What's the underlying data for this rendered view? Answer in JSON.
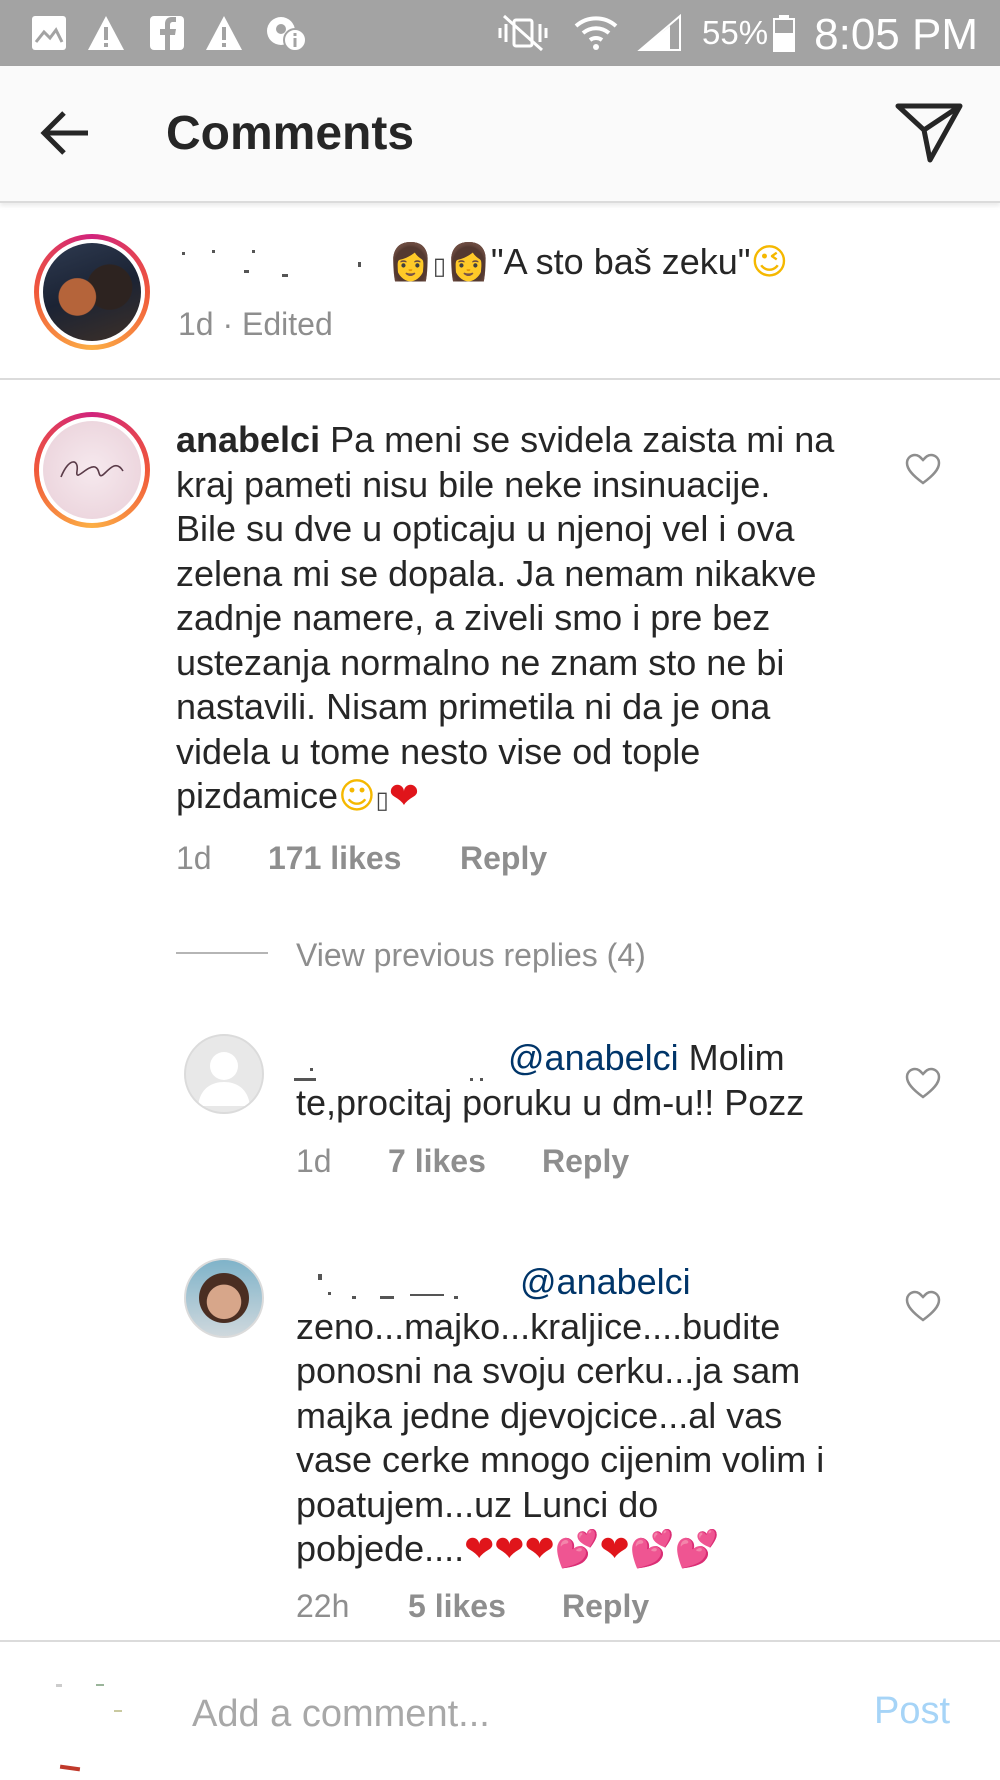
{
  "status_bar": {
    "battery": "55%",
    "time": "8:05 PM"
  },
  "header": {
    "title": "Comments"
  },
  "caption": {
    "text": "\"A sto baš zeku\"",
    "time": "1d · Edited"
  },
  "comment": {
    "username": "anabelci",
    "text_lines": [
      " Pa meni se svidela zaista mi na",
      "kraj pameti nisu bile neke insinuacije.",
      "Bile su dve u opticaju u njenoj vel i ova",
      "zelena mi se dopala. Ja nemam nikakve",
      "zadnje namere, a ziveli smo i pre bez",
      "ustezanja normalno ne znam sto ne bi",
      "nastavili. Nisam primetila ni da je ona",
      "videla u tome nesto vise od tople",
      "pizdamice"
    ],
    "time": "1d",
    "likes": "171 likes",
    "reply": "Reply"
  },
  "view_replies": "View previous replies (4)",
  "reply1": {
    "mention": "@anabelci",
    "line1": " Molim",
    "line2": "te,procitaj poruku u dm-u!! Pozz",
    "time": "1d",
    "likes": "7 likes",
    "reply": "Reply"
  },
  "reply2": {
    "mention": "@anabelci",
    "text_lines": [
      "zeno...majko...kraljice....budite",
      "ponosni na svoju cerku...ja sam",
      "majka jedne djevojcice...al vas",
      "vase cerke mnogo cijenim volim i",
      "poatujem...uz Lunci do",
      "pobjede...."
    ],
    "time": "22h",
    "likes": "5 likes",
    "reply": "Reply"
  },
  "composer": {
    "placeholder": "Add a comment...",
    "post": "Post"
  },
  "icons": {
    "back": "arrow-left-icon",
    "send": "paper-plane-icon",
    "heart": "heart-outline-icon"
  },
  "colors": {
    "mention": "#003569",
    "meta": "#8e8e8e",
    "post_disabled": "#a6d4f7",
    "status_bar": "#a3a3a3"
  }
}
